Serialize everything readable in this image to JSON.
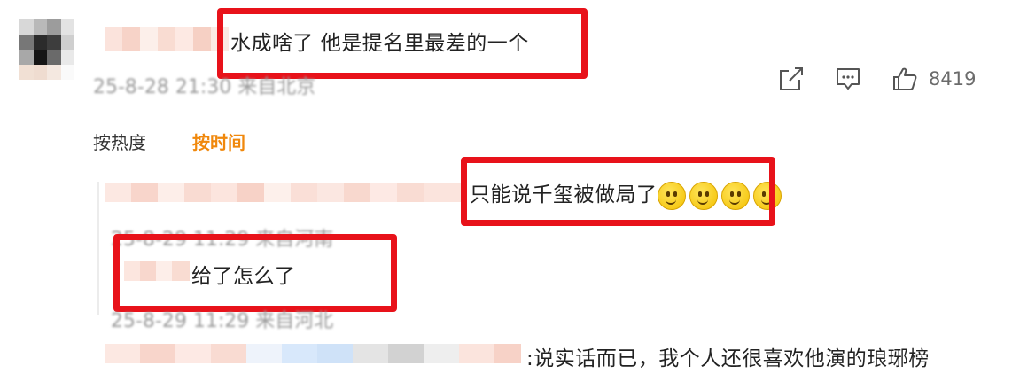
{
  "comment": {
    "text": "水成啥了 他是提名里最差的一个",
    "meta": "25-8-28 21:30 来自北京",
    "like_count": "8419",
    "icons": [
      "share-icon",
      "comment-icon",
      "like-icon"
    ]
  },
  "sort_tabs": {
    "hot": "按热度",
    "time": "按时间",
    "active": "time"
  },
  "replies": [
    {
      "text": "只能说千玺被做局了",
      "meta": "25-8-29 11:29 来自河南",
      "emoji_count": 4
    },
    {
      "text": "给了怎么了",
      "meta": "25-8-29 11:29 来自河北"
    },
    {
      "text": ":说实话而已，我个人还很喜欢他演的琅琊榜"
    }
  ],
  "colors": {
    "highlight_box": "#e8121a",
    "active_tab": "#f0880c",
    "meta_gray": "#9a9a9a"
  }
}
